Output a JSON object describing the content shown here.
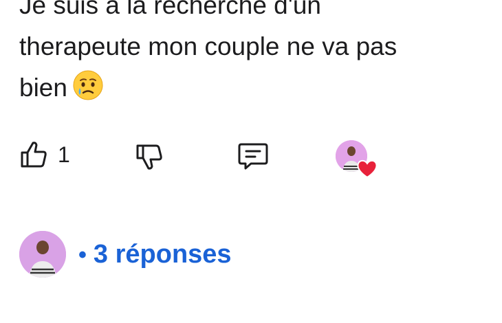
{
  "post": {
    "line1": "Je suis à la recherche d'un",
    "line2": "therapeute mon couple ne va pas",
    "line3": "bien"
  },
  "actions": {
    "like_count": "1"
  },
  "replies": {
    "bullet": "•",
    "label": "3 réponses"
  },
  "colors": {
    "link": "#1a62d6",
    "heart": "#e8213a",
    "avatar_bg": "#e2a3e8"
  },
  "icons": [
    "thumbs-up-icon",
    "thumbs-down-icon",
    "comment-icon",
    "heart-icon",
    "crying-face-emoji"
  ]
}
